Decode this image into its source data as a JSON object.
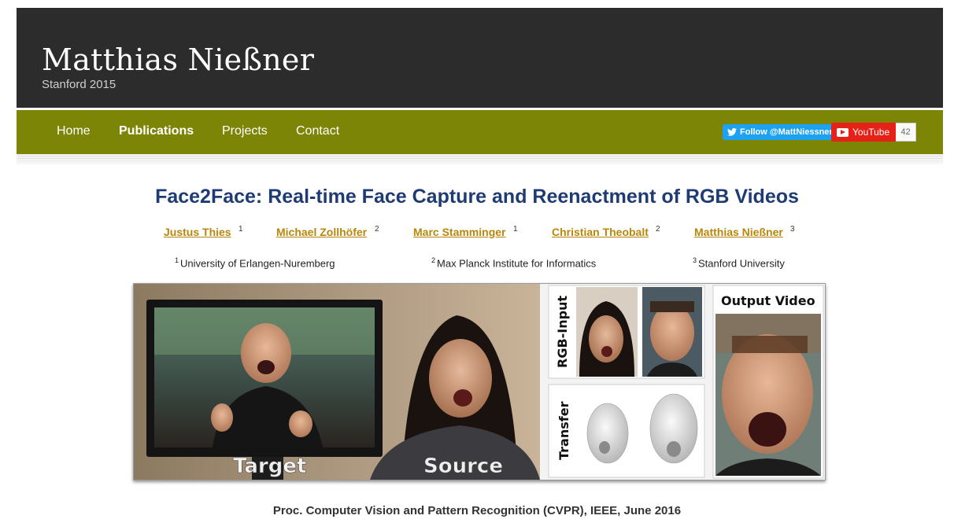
{
  "header": {
    "title": "Matthias Nießner",
    "subtitle": "Stanford 2015"
  },
  "nav": {
    "items": [
      {
        "label": "Home",
        "active": false
      },
      {
        "label": "Publications",
        "active": true
      },
      {
        "label": "Projects",
        "active": false
      },
      {
        "label": "Contact",
        "active": false
      }
    ],
    "twitter_label": "Follow @MattNiessner",
    "youtube_label": "YouTube",
    "youtube_count": "42"
  },
  "paper": {
    "title": "Face2Face: Real-time Face Capture and Reenactment of RGB Videos",
    "authors": [
      {
        "name": "Justus Thies",
        "aff": "1"
      },
      {
        "name": "Michael Zollhöfer",
        "aff": "2"
      },
      {
        "name": "Marc Stamminger",
        "aff": "1"
      },
      {
        "name": "Christian Theobalt",
        "aff": "2"
      },
      {
        "name": "Matthias Nießner",
        "aff": "3"
      }
    ],
    "affiliations": [
      {
        "num": "1",
        "name": "University of Erlangen-Nuremberg"
      },
      {
        "num": "2",
        "name": "Max Planck Institute for Informatics"
      },
      {
        "num": "3",
        "name": "Stanford University"
      }
    ],
    "teaser": {
      "target_label": "Target",
      "source_label": "Source",
      "rgb_input_label": "RGB-Input",
      "transfer_label": "Transfer",
      "output_label": "Output Video"
    },
    "publication": "Proc. Computer Vision and Pattern Recognition (CVPR), IEEE, June 2016"
  },
  "colors": {
    "header_bg": "#2c2c2c",
    "nav_bg": "#7d8507",
    "title_color": "#1f3b73",
    "author_color": "#b8860b",
    "twitter": "#1da1f2",
    "youtube": "#e62117"
  }
}
